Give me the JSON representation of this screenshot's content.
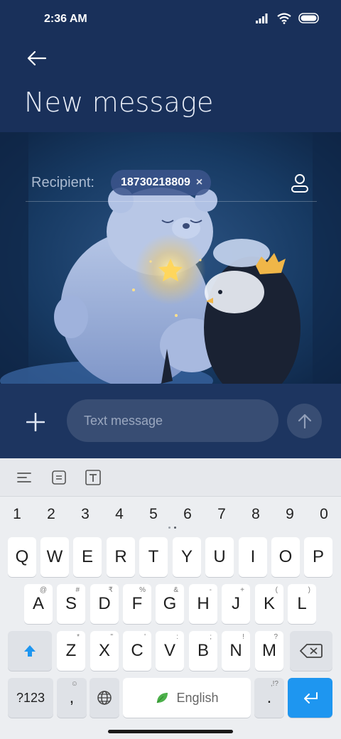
{
  "status_bar": {
    "time": "2:36 AM"
  },
  "header": {
    "title": "New message"
  },
  "recipient": {
    "label": "Recipient:",
    "chip_text": "18730218809",
    "chip_remove": "×"
  },
  "composer": {
    "placeholder": "Text message"
  },
  "keyboard": {
    "numbers": [
      "1",
      "2",
      "3",
      "4",
      "5",
      "6",
      "7",
      "8",
      "9",
      "0"
    ],
    "row1": [
      "Q",
      "W",
      "E",
      "R",
      "T",
      "Y",
      "U",
      "I",
      "O",
      "P"
    ],
    "row2": [
      {
        "label": "A",
        "hint": "@"
      },
      {
        "label": "S",
        "hint": "#"
      },
      {
        "label": "D",
        "hint": "₹"
      },
      {
        "label": "F",
        "hint": "%"
      },
      {
        "label": "G",
        "hint": "&"
      },
      {
        "label": "H",
        "hint": "-"
      },
      {
        "label": "J",
        "hint": "+"
      },
      {
        "label": "K",
        "hint": "("
      },
      {
        "label": "L",
        "hint": ")"
      }
    ],
    "row3": [
      {
        "label": "Z",
        "hint": "*"
      },
      {
        "label": "X",
        "hint": "\""
      },
      {
        "label": "C",
        "hint": "'"
      },
      {
        "label": "V",
        "hint": ":"
      },
      {
        "label": "B",
        "hint": ";"
      },
      {
        "label": "N",
        "hint": "!"
      },
      {
        "label": "M",
        "hint": "?"
      }
    ],
    "symbols_key": "?123",
    "comma_key": ",",
    "space_label": "English",
    "period_key": ".",
    "period_hint": ",!?"
  },
  "colors": {
    "app_bg": "#19305a",
    "accent": "#1e96f0",
    "keyboard_bg": "#eceef1"
  }
}
